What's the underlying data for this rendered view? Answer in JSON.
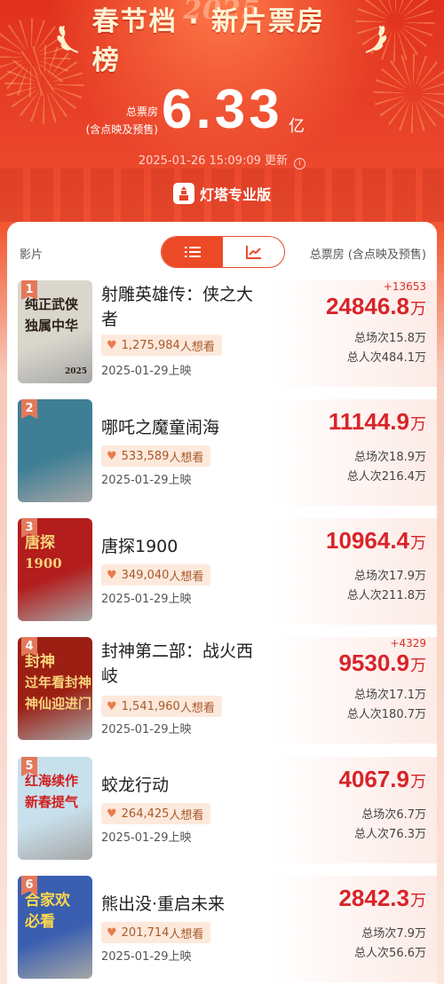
{
  "header": {
    "year": "2025",
    "title": "春节档 · 新片票房榜",
    "total_label_line1": "总票房",
    "total_label_line2": "(含点映及预售)",
    "total_value": "6.33",
    "total_unit": "亿",
    "updated_time": "2025-01-26 15:09:09",
    "updated_suffix": "更新",
    "brand": "灯塔专业版"
  },
  "table": {
    "col_film": "影片",
    "col_box": "总票房 (含点映及预售)",
    "view_modes": [
      "list-icon",
      "trend-chart-icon"
    ],
    "active_view": "list",
    "wan": "万",
    "shows_prefix": "总场次",
    "viewers_prefix": "总人次",
    "want_suffix": "人想看"
  },
  "films": [
    {
      "rank": "1",
      "title_l1": "射雕英雄传：侠之大",
      "title_l2": "者",
      "want": "1,275,984",
      "release": "2025-01-29上映",
      "delta": "+13653",
      "gross": "24846.8",
      "shows": "15.8万",
      "viewers": "484.1万"
    },
    {
      "rank": "2",
      "title_l1": "哪吒之魔童闹海",
      "title_l2": "",
      "want": "533,589",
      "release": "2025-01-29上映",
      "delta": "",
      "gross": "11144.9",
      "shows": "18.9万",
      "viewers": "216.4万"
    },
    {
      "rank": "3",
      "title_l1": "唐探1900",
      "title_l2": "",
      "want": "349,040",
      "release": "2025-01-29上映",
      "delta": "",
      "gross": "10964.4",
      "shows": "17.9万",
      "viewers": "211.8万"
    },
    {
      "rank": "4",
      "title_l1": "封神第二部：战火西",
      "title_l2": "岐",
      "want": "1,541,960",
      "release": "2025-01-29上映",
      "delta": "+4329",
      "gross": "9530.9",
      "shows": "17.1万",
      "viewers": "180.7万"
    },
    {
      "rank": "5",
      "title_l1": "蛟龙行动",
      "title_l2": "",
      "want": "264,425",
      "release": "2025-01-29上映",
      "delta": "",
      "gross": "4067.9",
      "shows": "6.7万",
      "viewers": "76.3万"
    },
    {
      "rank": "6",
      "title_l1": "熊出没·重启未来",
      "title_l2": "",
      "want": "201,714",
      "release": "2025-01-29上映",
      "delta": "",
      "gross": "2842.3",
      "shows": "7.9万",
      "viewers": "56.6万"
    }
  ],
  "posters": [
    {
      "lines": [
        "纯正武侠",
        "独属中华"
      ],
      "small": "2025",
      "bg": "#d9d6cc",
      "fg": "#2a2018"
    },
    {
      "lines": [],
      "small": "",
      "bg": "#3f7f96",
      "fg": "#ffffff"
    },
    {
      "lines": [
        "唐探",
        "1900"
      ],
      "small": "",
      "bg": "#b31d1d",
      "fg": "#f5d27a"
    },
    {
      "lines": [
        "封神",
        "过年看封神",
        "神仙迎进门"
      ],
      "small": "",
      "bg": "#9c1f14",
      "fg": "#f7d27c"
    },
    {
      "lines": [
        "红海续作",
        "新春提气"
      ],
      "small": "",
      "bg": "#c8e0ec",
      "fg": "#d01f1f"
    },
    {
      "lines": [
        "合家欢",
        "必看"
      ],
      "small": "",
      "bg": "#3a5fb0",
      "fg": "#ffd84a"
    }
  ]
}
